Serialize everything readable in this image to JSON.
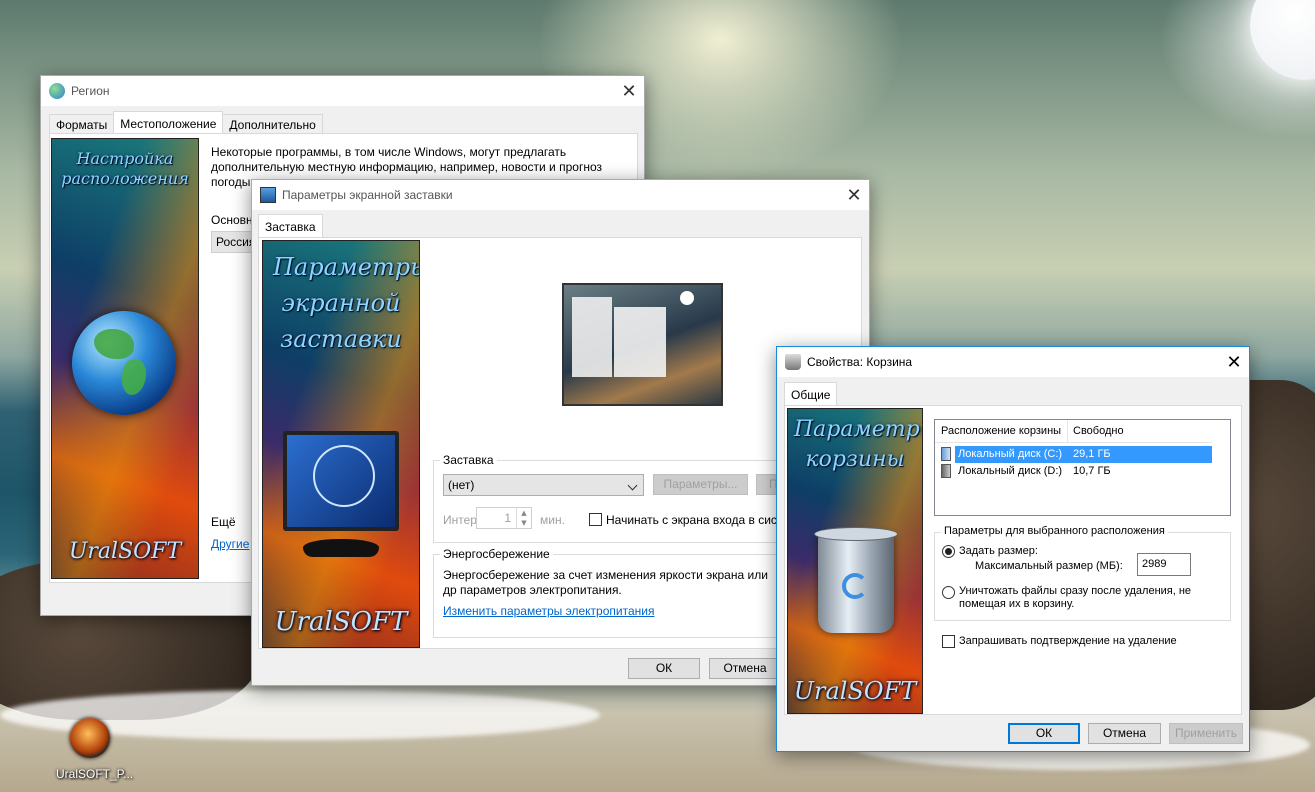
{
  "desktop": {
    "icon_label": "UralSOFT_P..."
  },
  "region": {
    "title": "Регион",
    "tabs": [
      "Форматы",
      "Местоположение",
      "Дополнительно"
    ],
    "selected_tab": "Местоположение",
    "description": "Некоторые программы, в том числе Windows, могут предлагать дополнительную местную информацию, например, новости и прогноз погоды",
    "home_location_label": "Основн",
    "home_location_value": "Россия",
    "more_label": "Ещё",
    "other_link": "Другие",
    "banner_title": "Настройка расположения",
    "banner_brand": "UralSOFT"
  },
  "screensaver": {
    "title": "Параметры экранной заставки",
    "tab": "Заставка",
    "banner_title": "Параметры экранной заставки",
    "banner_brand": "UralSOFT",
    "group_label": "Заставка",
    "select_value": "(нет)",
    "settings_button": "Параметры...",
    "preview_button": "П",
    "interval_label": "Интер",
    "interval_value": "1",
    "minutes_label": "мин.",
    "logon_checkbox": "Начинать с экрана входа в сист",
    "power_group_label": "Энергосбережение",
    "power_text": "Энергосбережение за счет изменения яркости экрана или др параметров электропитания.",
    "power_link": "Изменить параметры электропитания",
    "ok": "ОК",
    "cancel": "Отмена"
  },
  "recycle": {
    "title": "Свойства: Корзина",
    "tab": "Общие",
    "banner_title": "Параметры корзины",
    "banner_brand": "UralSOFT",
    "columns": [
      "Расположение корзины",
      "Свободно"
    ],
    "rows": [
      {
        "name": "Локальный диск (C:)",
        "free": "29,1 ГБ",
        "selected": true
      },
      {
        "name": "Локальный диск (D:)",
        "free": "10,7 ГБ",
        "selected": false
      }
    ],
    "group_label": "Параметры для выбранного расположения",
    "custom_size_label": "Задать размер:",
    "max_size_label": "Максимальный размер (МБ):",
    "max_size_value": "2989",
    "delete_immediately_label": "Уничтожать файлы сразу после удаления, не помещая их в корзину.",
    "confirm_label": "Запрашивать подтверждение на удаление",
    "ok": "ОК",
    "cancel": "Отмена",
    "apply": "Применить"
  },
  "colors": {
    "accent": "#0078d7",
    "selection": "#3399ff",
    "link": "#0066cc"
  }
}
